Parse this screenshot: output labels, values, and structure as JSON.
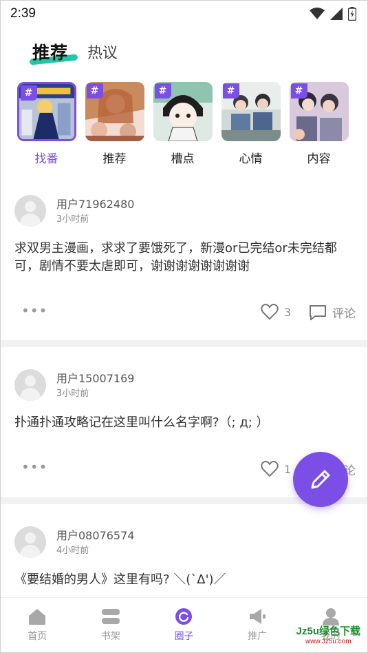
{
  "status_bar": {
    "time": "2:39"
  },
  "header": {
    "tabs": [
      {
        "label": "推荐",
        "active": true
      },
      {
        "label": "热议",
        "active": false
      }
    ]
  },
  "topics": [
    {
      "label": "找番",
      "selected": true,
      "hash": "#"
    },
    {
      "label": "推荐",
      "selected": false,
      "hash": "#"
    },
    {
      "label": "槽点",
      "selected": false,
      "hash": "#"
    },
    {
      "label": "心情",
      "selected": false,
      "hash": "#"
    },
    {
      "label": "内容",
      "selected": false,
      "hash": "#"
    }
  ],
  "posts": [
    {
      "username": "用户71962480",
      "time": "3小时前",
      "text": "求双男主漫画，求求了要饿死了，新漫or已完结or未完结都可，剧情不要太虐即可，谢谢谢谢谢谢谢谢",
      "more": "•••",
      "likes": "3",
      "comment_label": "评论"
    },
    {
      "username": "用户15007169",
      "time": "3小时前",
      "text": "扑通扑通攻略记在这里叫什么名字啊?（;  д;  ）",
      "more": "•••",
      "likes": "1",
      "comment_label": "评论"
    },
    {
      "username": "用户08076574",
      "time": "4小时前",
      "text": "《要结婚的男人》这里有吗? ＼(`Δ')／"
    }
  ],
  "bottom_nav": [
    {
      "label": "首页",
      "icon": "home-icon",
      "active": false
    },
    {
      "label": "书架",
      "icon": "bookshelf-icon",
      "active": false
    },
    {
      "label": "圈子",
      "icon": "circle-icon",
      "active": true
    },
    {
      "label": "推广",
      "icon": "megaphone-icon",
      "active": false
    },
    {
      "label": "我的",
      "icon": "profile-icon",
      "active": false
    }
  ],
  "watermark": {
    "main": "Jz5u绿色下载",
    "sub": "www.Jz5u.com"
  },
  "colors": {
    "accent": "#7b4ee6",
    "tab_underline": "#1fc7a4"
  }
}
